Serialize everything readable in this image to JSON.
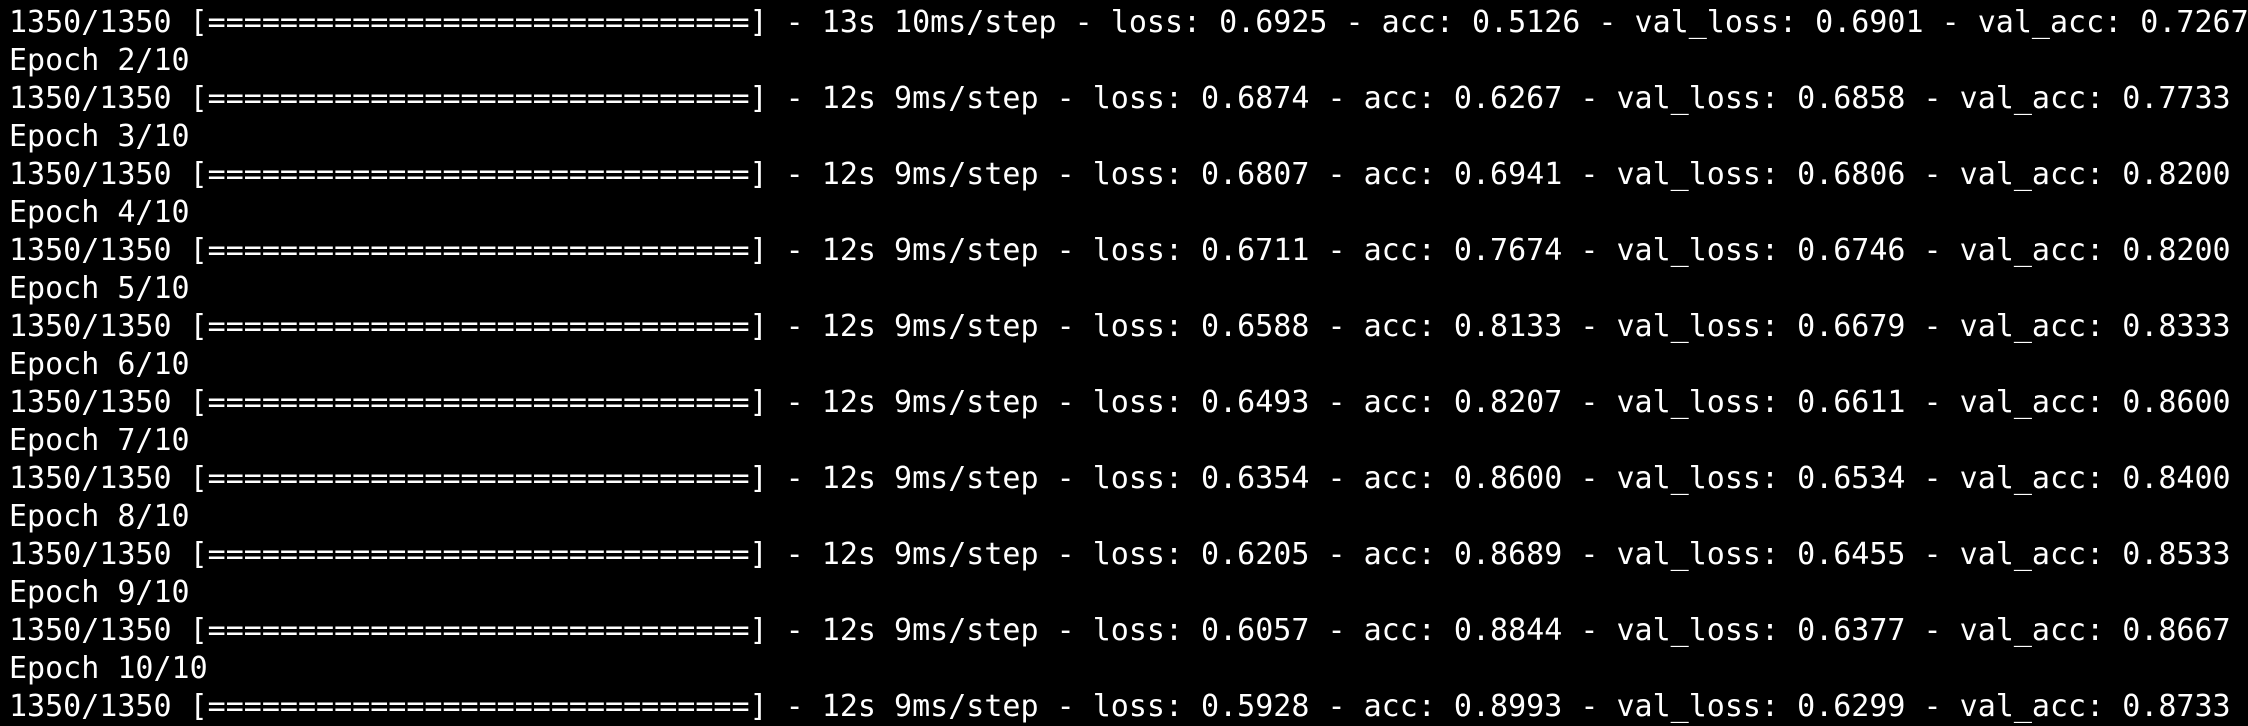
{
  "terminal": {
    "lines": [
      "1350/1350 [==============================] - 13s 10ms/step - loss: 0.6925 - acc: 0.5126 - val_loss: 0.6901 - val_acc: 0.7267",
      "Epoch 2/10",
      "1350/1350 [==============================] - 12s 9ms/step - loss: 0.6874 - acc: 0.6267 - val_loss: 0.6858 - val_acc: 0.7733",
      "Epoch 3/10",
      "1350/1350 [==============================] - 12s 9ms/step - loss: 0.6807 - acc: 0.6941 - val_loss: 0.6806 - val_acc: 0.8200",
      "Epoch 4/10",
      "1350/1350 [==============================] - 12s 9ms/step - loss: 0.6711 - acc: 0.7674 - val_loss: 0.6746 - val_acc: 0.8200",
      "Epoch 5/10",
      "1350/1350 [==============================] - 12s 9ms/step - loss: 0.6588 - acc: 0.8133 - val_loss: 0.6679 - val_acc: 0.8333",
      "Epoch 6/10",
      "1350/1350 [==============================] - 12s 9ms/step - loss: 0.6493 - acc: 0.8207 - val_loss: 0.6611 - val_acc: 0.8600",
      "Epoch 7/10",
      "1350/1350 [==============================] - 12s 9ms/step - loss: 0.6354 - acc: 0.8600 - val_loss: 0.6534 - val_acc: 0.8400",
      "Epoch 8/10",
      "1350/1350 [==============================] - 12s 9ms/step - loss: 0.6205 - acc: 0.8689 - val_loss: 0.6455 - val_acc: 0.8533",
      "Epoch 9/10",
      "1350/1350 [==============================] - 12s 9ms/step - loss: 0.6057 - acc: 0.8844 - val_loss: 0.6377 - val_acc: 0.8667",
      "Epoch 10/10",
      "1350/1350 [==============================] - 12s 9ms/step - loss: 0.5928 - acc: 0.8993 - val_loss: 0.6299 - val_acc: 0.8733"
    ],
    "colors": {
      "background": "#000000",
      "text": "#ffffff"
    }
  }
}
